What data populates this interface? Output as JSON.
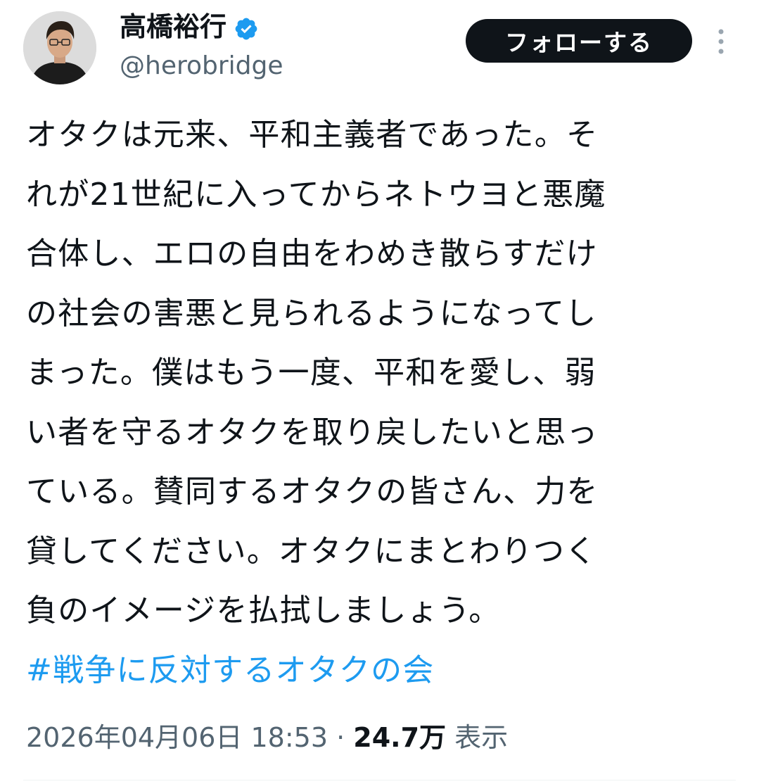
{
  "author": {
    "display_name": "高橋裕行",
    "handle": "@herobridge",
    "verified": true,
    "verified_color": "#1d9bf0"
  },
  "actions": {
    "follow_label": "フォローする",
    "more_icon": "more-vertical-icon"
  },
  "tweet": {
    "lines": [
      "オタクは元来、平和主義者であった。そ",
      "れが21世紀に入ってからネトウヨと悪魔",
      "合体し、エロの自由をわめき散らすだけ",
      "の社会の害悪と見られるようになってし",
      "まった。僕はもう一度、平和を愛し、弱",
      "い者を守るオタクを取り戻したいと思っ",
      "ている。賛同するオタクの皆さん、力を",
      "貸してください。オタクにまとわりつく",
      "負のイメージを払拭しましょう。"
    ],
    "hashtag": "#戦争に反対するオタクの会",
    "hashtag_color": "#1d9bf0"
  },
  "meta": {
    "timestamp": "2026年04月06日 18:53",
    "separator": " · ",
    "views_count": "24.7万",
    "views_label": " 表示"
  }
}
